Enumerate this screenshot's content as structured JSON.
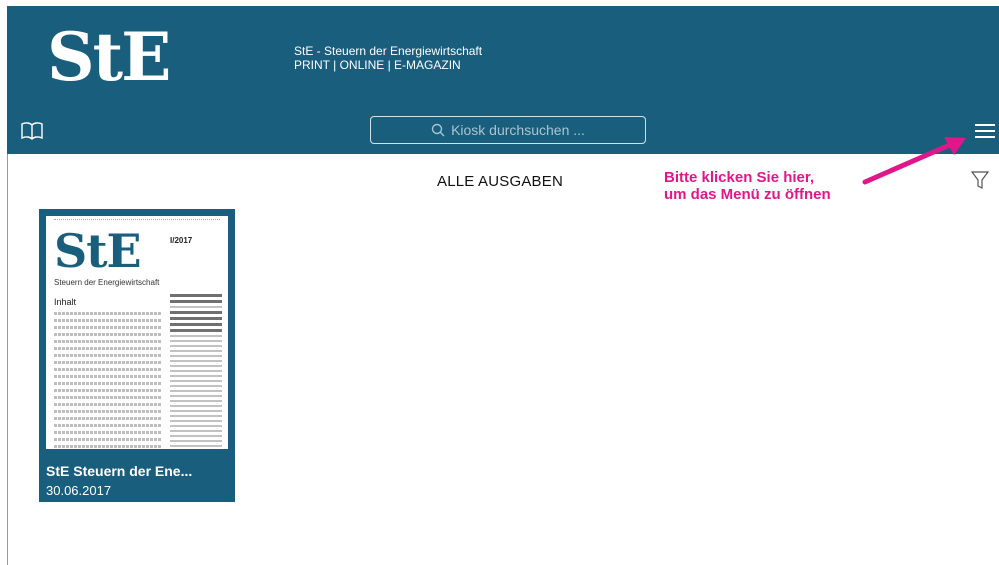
{
  "header": {
    "logo": "StE",
    "subtitle_line1": "StE - Steuern der Energiewirtschaft",
    "subtitle_line2": "PRINT | ONLINE | E-MAGAZIN",
    "search_placeholder": "Kiosk durchsuchen ..."
  },
  "main": {
    "section_title": "ALLE AUSGABEN",
    "annotation_line1": "Bitte klicken Sie hier,",
    "annotation_line2": "um das Menü zu öffnen"
  },
  "issues": [
    {
      "title": "StE Steuern der Ene...",
      "date": "30.06.2017",
      "cover_logo": "StE",
      "cover_subtitle": "Steuern der Energiewirtschaft",
      "cover_issue": "I/2017",
      "cover_toc_heading": "Inhalt"
    }
  ],
  "colors": {
    "brand": "#1a5e7d",
    "annotation": "#e0178a"
  },
  "icons": {
    "book": "book-icon",
    "search": "search-icon",
    "menu": "hamburger-menu-icon",
    "filter": "filter-icon"
  }
}
